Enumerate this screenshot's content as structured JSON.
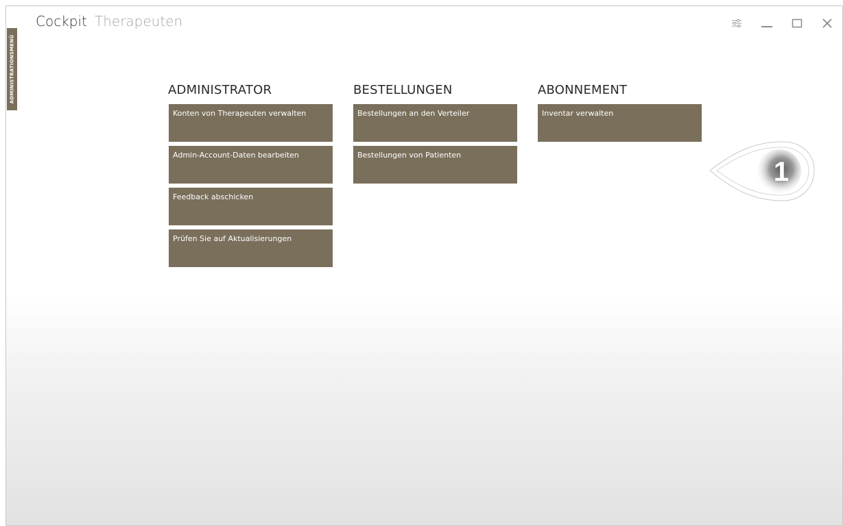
{
  "sidebar": {
    "label": "ADMINISTRATIONSMENÜ"
  },
  "header": {
    "title": "Cockpit",
    "subtitle": "Therapeuten"
  },
  "window_controls": {
    "settings_icon": "settings-sliders-icon",
    "minimize_icon": "minimize-icon",
    "maximize_icon": "maximize-icon",
    "close_icon": "close-icon"
  },
  "columns": [
    {
      "title": "ADMINISTRATOR",
      "tiles": [
        "Konten von Therapeuten verwalten",
        "Admin-Account-Daten bearbeiten",
        "Feedback abschicken",
        "Prüfen Sie auf Aktualisierungen"
      ]
    },
    {
      "title": "BESTELLUNGEN",
      "tiles": [
        "Bestellungen an den Verteiler",
        "Bestellungen von Patienten"
      ]
    },
    {
      "title": "ABONNEMENT",
      "tiles": [
        "Inventar verwalten"
      ]
    }
  ],
  "callout": {
    "number": "1"
  },
  "colors": {
    "tile": "#7a6f5b",
    "tile_text": "#ffffff",
    "title_secondary": "#a6a6a6"
  }
}
